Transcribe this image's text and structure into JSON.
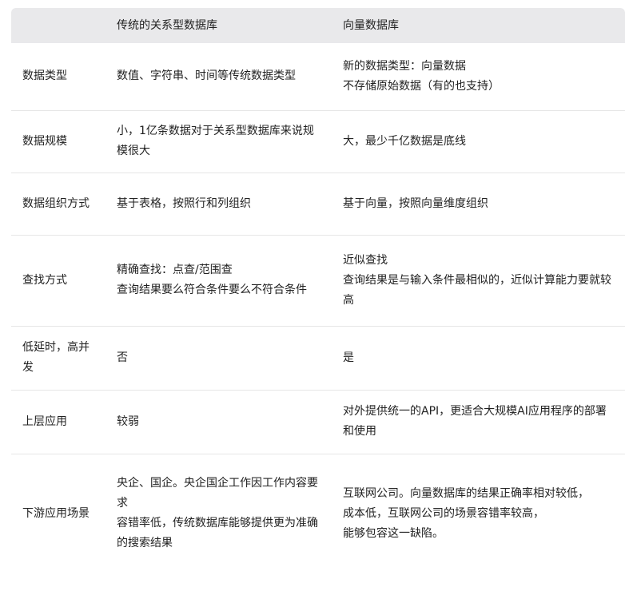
{
  "table": {
    "headers": [
      "",
      "传统的关系型数据库",
      "向量数据库"
    ],
    "rows": [
      {
        "label": "数据类型",
        "traditional": [
          "数值、字符串、时间等传统数据类型"
        ],
        "vector": [
          "新的数据类型：向量数据",
          "不存储原始数据（有的也支持）"
        ]
      },
      {
        "label": "数据规模",
        "traditional": [
          "小，1亿条数据对于关系型数据库来说规模很大"
        ],
        "vector": [
          "大，最少千亿数据是底线"
        ]
      },
      {
        "label": "数据组织方式",
        "traditional": [
          "基于表格，按照行和列组织"
        ],
        "vector": [
          "基于向量，按照向量维度组织"
        ]
      },
      {
        "label": "查找方式",
        "traditional": [
          "精确查找：点查/范围查",
          "查询结果要么符合条件要么不符合条件"
        ],
        "vector": [
          "近似查找",
          "查询结果是与输入条件最相似的，近似计算能力要就较高"
        ]
      },
      {
        "label": "低延时，高并发",
        "traditional": [
          "否"
        ],
        "vector": [
          "是"
        ]
      },
      {
        "label": "上层应用",
        "traditional": [
          "较弱"
        ],
        "vector": [
          "对外提供统一的API，更适合大规模AI应用程序的部署和使用"
        ]
      },
      {
        "label": "下游应用场景",
        "traditional": [
          "央企、国企。央企国企工作因工作内容要求",
          "容错率低，传统数据库能够提供更为准确",
          "的搜索结果"
        ],
        "vector": [
          "互联网公司。向量数据库的结果正确率相对较低，",
          "成本低，互联网公司的场景容错率较高，",
          "能够包容这一缺陷。"
        ]
      }
    ]
  }
}
